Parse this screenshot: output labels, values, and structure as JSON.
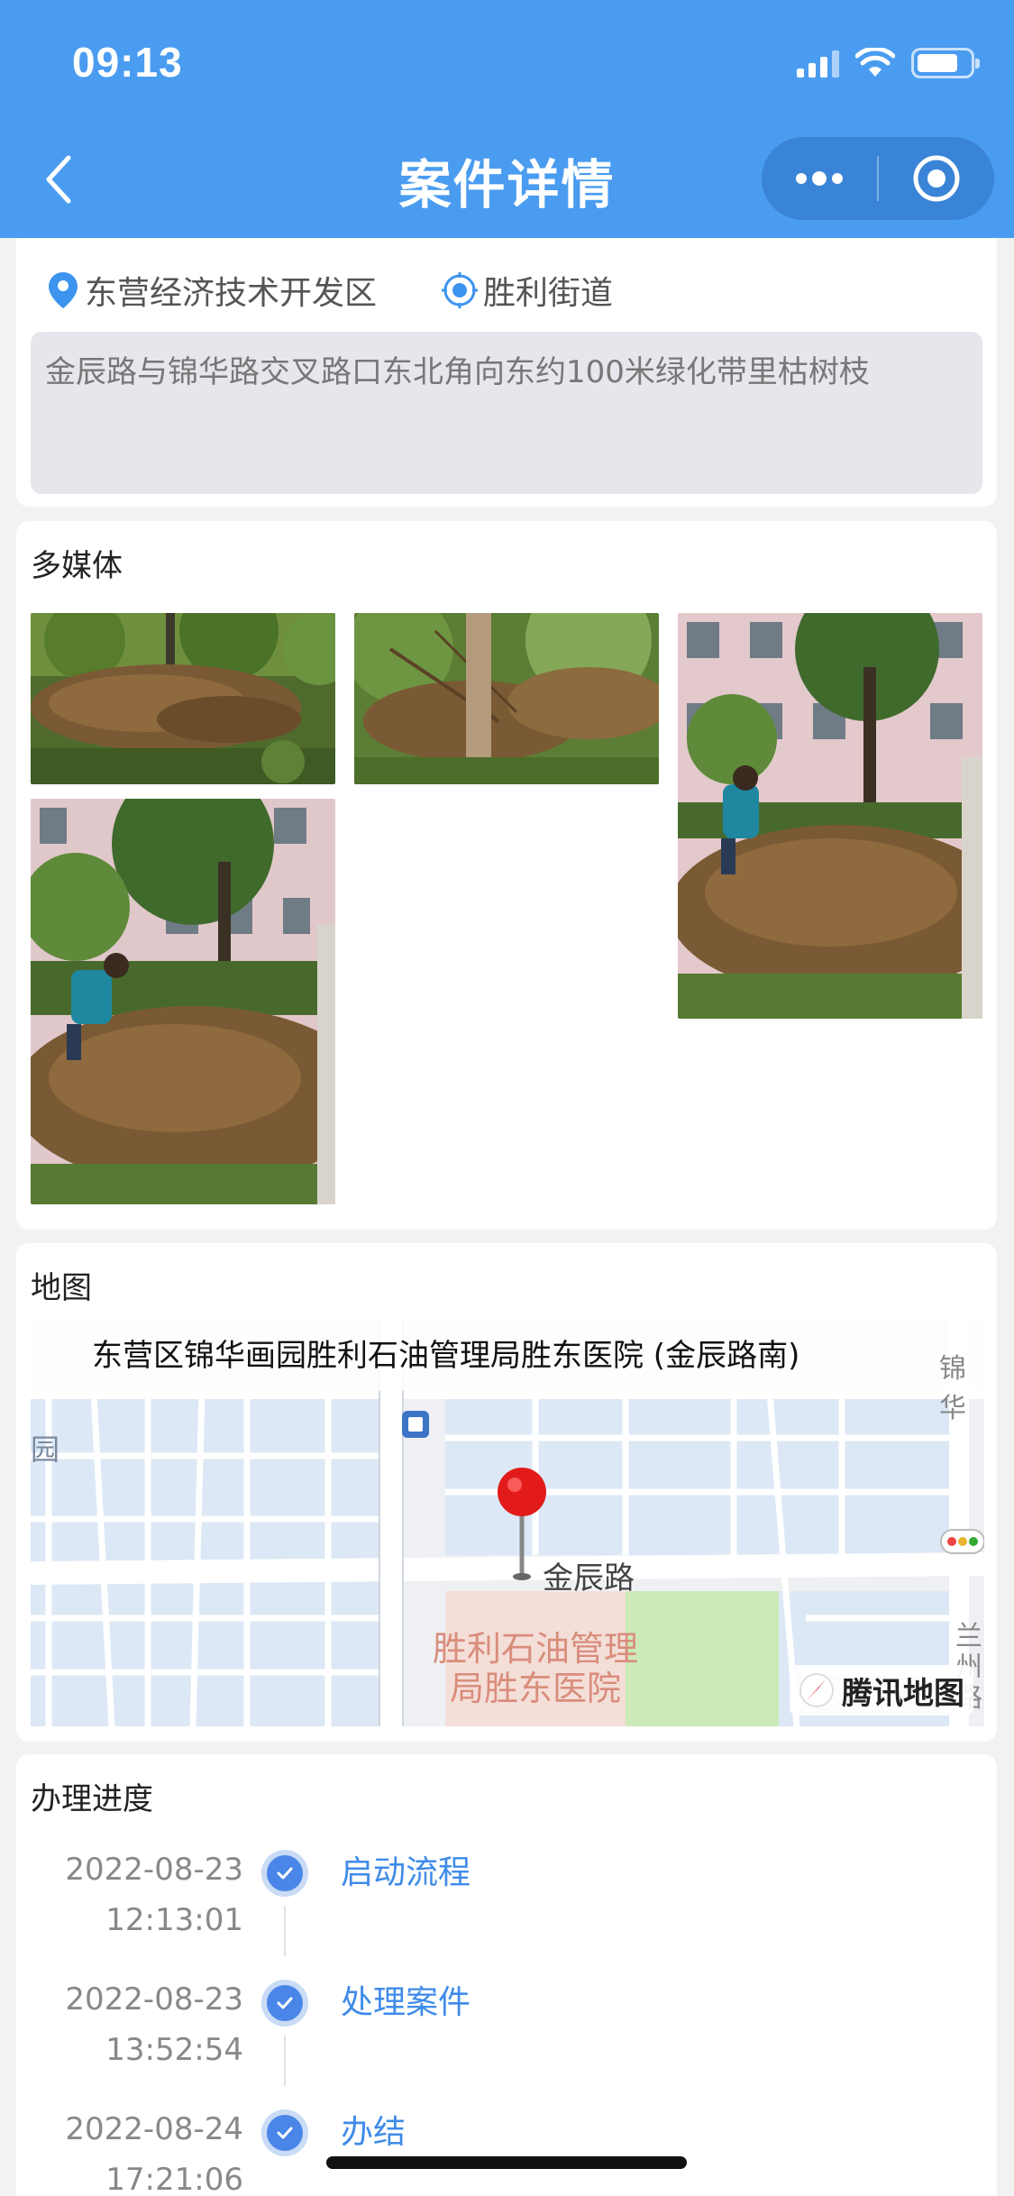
{
  "status_bar": {
    "time": "09:13"
  },
  "nav": {
    "title": "案件详情"
  },
  "address": {
    "district": "东营经济技术开发区",
    "street": "胜利街道",
    "description": "金辰路与锦华路交叉路口东北角向东约100米绿化带里枯树枝"
  },
  "media": {
    "title": "多媒体",
    "photo_count": 4
  },
  "map": {
    "title": "地图",
    "place_label": "东营区锦华画园胜利石油管理局胜东医院 (金辰路南)",
    "road_label": "金辰路",
    "poi_label_line1": "胜利石油管理",
    "poi_label_line2": "局胜东医院",
    "edge_label_left": "园",
    "edge_label_right": "锦华",
    "edge_label_bottom_right": "兰州路",
    "provider": "腾讯地图"
  },
  "progress": {
    "title": "办理进度",
    "steps": [
      {
        "date": "2022-08-23",
        "time": "12:13:01",
        "label": "启动流程"
      },
      {
        "date": "2022-08-23",
        "time": "13:52:54",
        "label": "处理案件"
      },
      {
        "date": "2022-08-24",
        "time": "17:21:06",
        "label": "办结"
      }
    ]
  },
  "colors": {
    "accent": "#4a9cf0",
    "step_blue": "#4a86e8",
    "link_blue": "#3f8be8"
  }
}
